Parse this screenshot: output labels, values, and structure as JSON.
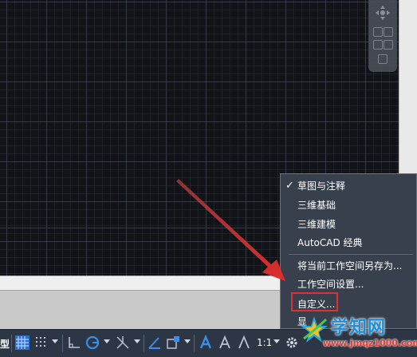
{
  "status_bar": {
    "model_label": "型",
    "scale": "1:1"
  },
  "workspace_menu": {
    "items": [
      {
        "label": "草图与注释",
        "checked": true
      },
      {
        "label": "三维基础",
        "checked": false
      },
      {
        "label": "三维建模",
        "checked": false
      },
      {
        "label": "AutoCAD 经典",
        "checked": false
      },
      {
        "label": "将当前工作空间另存为...",
        "checked": false
      },
      {
        "label": "工作空间设置...",
        "checked": false
      },
      {
        "label": "自定义...",
        "checked": false
      },
      {
        "label": "显",
        "checked": false
      }
    ],
    "check_glyph": "✓"
  },
  "watermark": {
    "title": "学知网",
    "url": "www.jmqz1000.com"
  },
  "colors": {
    "canvas": "#111317",
    "menu_bg": "#39404d",
    "status_bg": "#2d3644",
    "accent_blue": "#3a8ee6",
    "highlight_red": "#e03030"
  }
}
